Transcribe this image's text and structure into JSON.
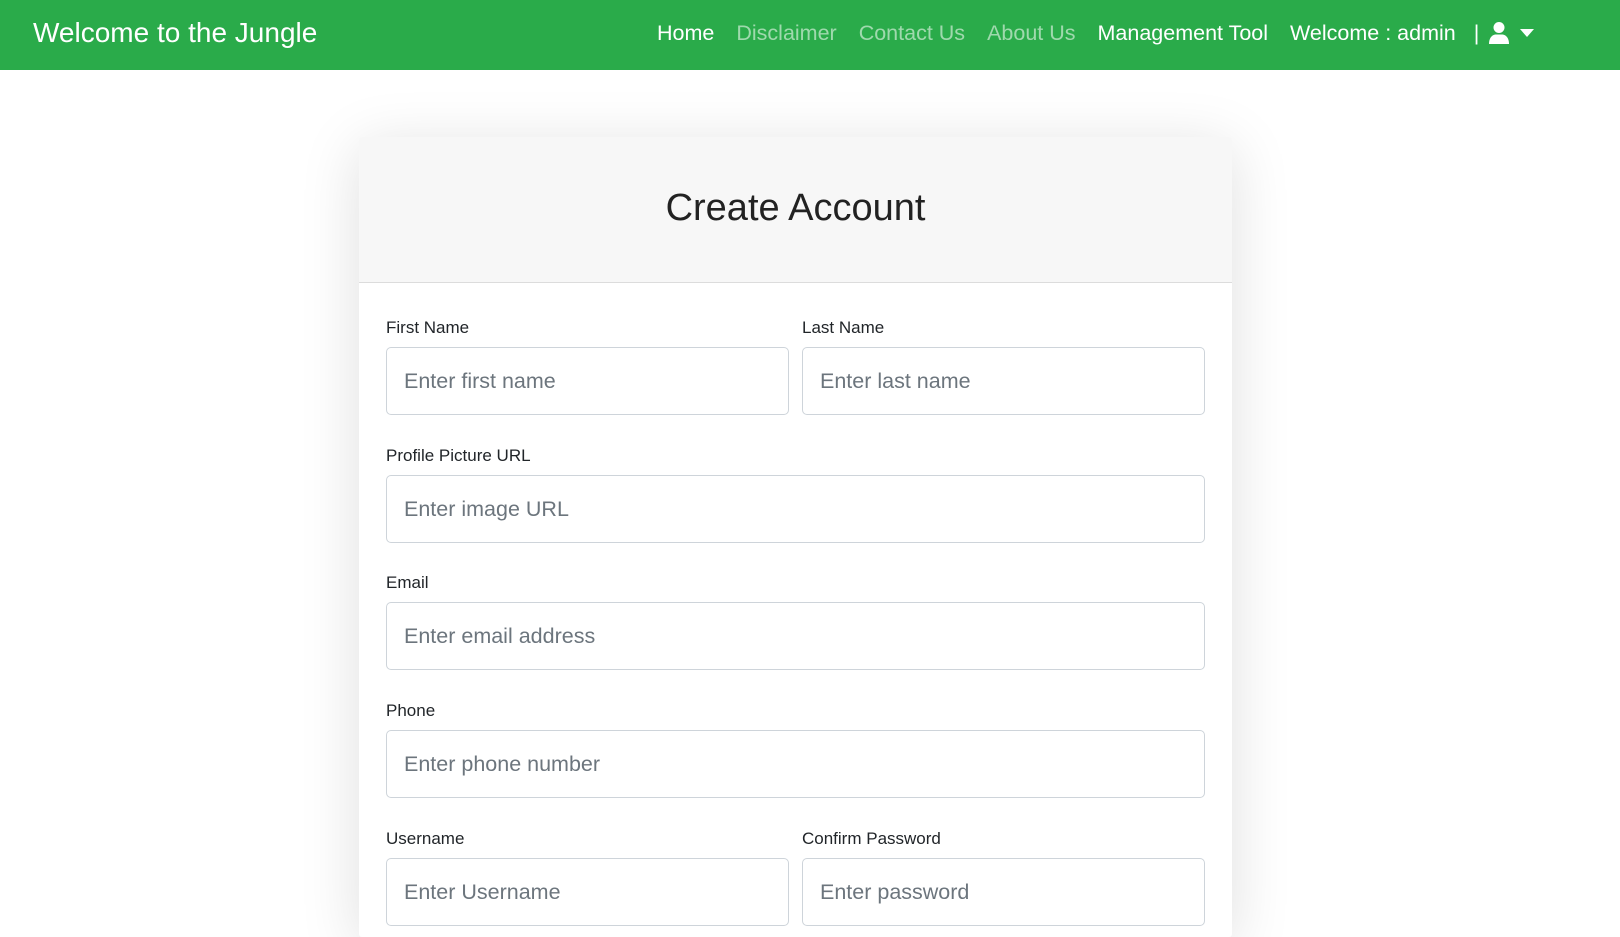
{
  "navbar": {
    "brand": "Welcome to the Jungle",
    "links": [
      {
        "label": "Home"
      },
      {
        "label": "Disclaimer"
      },
      {
        "label": "Contact Us"
      },
      {
        "label": "About Us"
      },
      {
        "label": "Management Tool"
      }
    ],
    "welcome": "Welcome : admin",
    "separator": "|",
    "user_icon": "user-icon",
    "dropdown_icon": "caret-down-icon",
    "color": "#2aab4a"
  },
  "form": {
    "title": "Create Account",
    "first_name": {
      "label": "First Name",
      "placeholder": "Enter first name"
    },
    "last_name": {
      "label": "Last Name",
      "placeholder": "Enter last name"
    },
    "profile_picture": {
      "label": "Profile Picture URL",
      "placeholder": "Enter image URL"
    },
    "email": {
      "label": "Email",
      "placeholder": "Enter email address"
    },
    "phone": {
      "label": "Phone",
      "placeholder": "Enter phone number"
    },
    "username": {
      "label": "Username",
      "placeholder": "Enter Username"
    },
    "confirm_password": {
      "label": "Confirm Password",
      "placeholder": "Enter password"
    }
  }
}
